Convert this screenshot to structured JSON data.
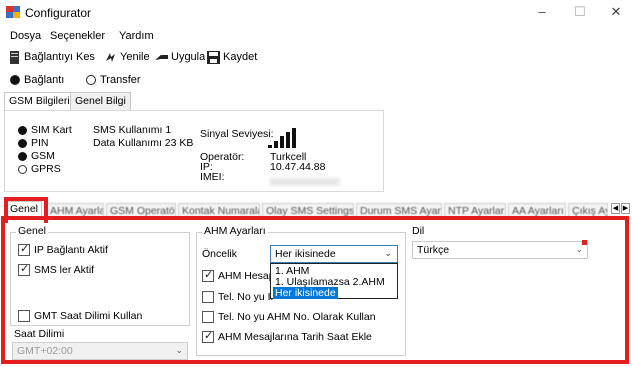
{
  "window": {
    "title": "Configurator",
    "controls": [
      "–",
      "☐",
      "✕"
    ]
  },
  "menu": [
    "Dosya",
    "Seçenekler",
    "Yardım"
  ],
  "toolbar": {
    "disconnect": "Bağlantıyı Kes",
    "refresh": "Yenile",
    "apply": "Uygula",
    "save": "Kaydet"
  },
  "mode": {
    "connection": "Bağlantı",
    "transfer": "Transfer"
  },
  "info_tabs": [
    "GSM Bilgileri",
    "Genel Bilgi"
  ],
  "status": {
    "sim": "SIM Kart",
    "pin": "PIN",
    "gsm": "GSM",
    "gprs": "GPRS",
    "sms_usage": "SMS Kullanımı  1",
    "data_usage": "Data Kullanımı  23 KB",
    "signal_label": "Sinyal Seviyesi:",
    "operator_label": "Operatör:",
    "operator_value": "Turkcell",
    "ip_label": "IP:",
    "ip_value": "10.47.44.88",
    "imei_label": "IMEI:"
  },
  "main_tabs": [
    "Genel",
    "AHM Ayarları",
    "GSM Operatörü",
    "Kontak Numaraları",
    "Olay SMS Settings",
    "Durum SMS Ayarları",
    "NTP Ayarları",
    "AA Ayarları",
    "Çıkış Ay"
  ],
  "genel": {
    "group_label": "Genel",
    "ip_connection": "IP Bağlantı Aktif",
    "sms_active": "SMS ler Aktif",
    "gmt_use": "GMT Saat Dilimi Kullan",
    "timezone_label": "Saat Dilimi",
    "timezone_value": "GMT+02:00"
  },
  "ahm": {
    "group_label": "AHM Ayarları",
    "priority_label": "Öncelik",
    "priority_value": "Her ikisinede",
    "options": [
      "1. AHM",
      "1. Ulaşılamazsa 2.AHM",
      "Her ikisinede"
    ],
    "account": "AHM Hesap",
    "tel_ip": "Tel. No yu IP",
    "tel_ahm": "Tel. No yu AHM No. Olarak Kullan",
    "add_date": "AHM Mesajlarına Tarih Saat Ekle"
  },
  "language": {
    "group_label": "Dil",
    "value": "Türkçe"
  }
}
